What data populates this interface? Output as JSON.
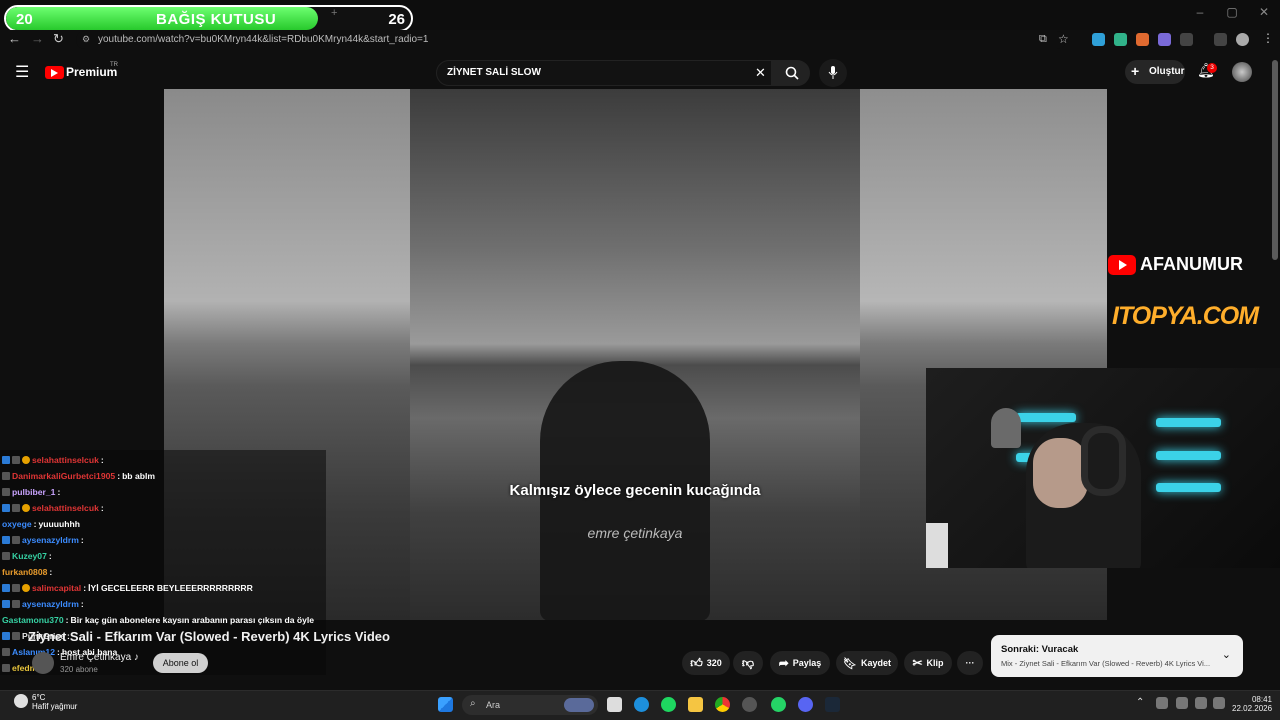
{
  "donation": {
    "left_value": "20",
    "title": "BAĞIŞ KUTUSU",
    "right_value": "26",
    "progress": 0.77
  },
  "browser": {
    "url": "youtube.com/watch?v=bu0KMryn44k&list=RDbu0KMryn44k&start_radio=1",
    "window_controls": [
      "–",
      "▢",
      "✕"
    ]
  },
  "youtube": {
    "logo": "Premium",
    "logo_badge": "TR",
    "search_value": "ZİYNET SALİ SLOW",
    "create_label": "Oluştur",
    "notification_count": "3"
  },
  "video": {
    "lyric": "Kalmışız öylece gecenin kucağında",
    "credit": "emre çetinkaya"
  },
  "overlay": {
    "channel_brand": "AFANUMUR",
    "sponsor": "ITOPYA.COM"
  },
  "chat": [
    {
      "user": "selahattinselcuk",
      "sep": " : ",
      "msg": "",
      "color": "#e03535",
      "badges": [
        "b1",
        "b2",
        "b3"
      ]
    },
    {
      "user": "DanimarkaliGurbetci1905",
      "sep": " : ",
      "msg": "bb ablm",
      "color": "#e03535",
      "badges": [
        "b2"
      ]
    },
    {
      "user": "pulbiber_1",
      "sep": " : ",
      "msg": "",
      "color": "#c9a3ff",
      "badges": [
        "b2"
      ]
    },
    {
      "user": "selahattinselcuk",
      "sep": " : ",
      "msg": "",
      "color": "#e03535",
      "badges": [
        "b1",
        "b2",
        "b3"
      ]
    },
    {
      "user": "oxyege",
      "sep": " : ",
      "msg": "yuuuuhhh",
      "color": "#3c8cff",
      "badges": []
    },
    {
      "user": "aysenazyldrm",
      "sep": " : ",
      "msg": "",
      "color": "#3c8cff",
      "badges": [
        "b1",
        "b2"
      ]
    },
    {
      "user": "Kuzey07",
      "sep": " : ",
      "msg": "",
      "color": "#36d1a3",
      "badges": [
        "b2"
      ]
    },
    {
      "user": "furkan0808",
      "sep": " : ",
      "msg": "",
      "color": "#e89b2c",
      "badges": []
    },
    {
      "user": "salimcapital",
      "sep": " : ",
      "msg": "İYİ GECELEERR BEYLEEERRRRRRRRR",
      "color": "#e03535",
      "badges": [
        "b1",
        "b2",
        "b3"
      ]
    },
    {
      "user": "aysenazyldrm",
      "sep": " : ",
      "msg": "",
      "color": "#3c8cff",
      "badges": [
        "b1",
        "b2"
      ]
    },
    {
      "user": "Gastamonu370",
      "sep": " : ",
      "msg": "Bir kaç gün abonelere kaysın arabanın parası çıksın da öyle",
      "color": "#36d1a3",
      "badges": []
    },
    {
      "user": "PunkGrise",
      "sep": " : ",
      "msg": "",
      "color": "#e6e6e6",
      "badges": [
        "b1",
        "b2"
      ]
    },
    {
      "user": "Aslanım12",
      "sep": " : ",
      "msg": "host abi bana",
      "color": "#3c8cff",
      "badges": [
        "b2"
      ]
    },
    {
      "user": "efedmf",
      "sep": " : ",
      "msg": "",
      "color": "#e6c33b",
      "badges": [
        "b2"
      ]
    }
  ],
  "video_info": {
    "title": "Ziynet Sali - Efkarım Var (Slowed - Reverb) 4K Lyrics Video",
    "channel": "Emre Çetinkaya ♪",
    "subscribers": "320 abone",
    "subscribe_label": "Abone ol",
    "likes": "320",
    "share": "Paylaş",
    "save": "Kaydet",
    "clip": "Klip",
    "more": "···"
  },
  "up_next": {
    "heading": "Sonraki: Vuracak",
    "subtitle": "Mix - Ziynet Sali - Efkarım Var (Slowed - Reverb) 4K Lyrics Vi..."
  },
  "taskbar": {
    "temperature": "6°C",
    "weather": "Hafif yağmur",
    "search_placeholder": "Ara",
    "time": "08:41",
    "date": "22.02.2026"
  }
}
